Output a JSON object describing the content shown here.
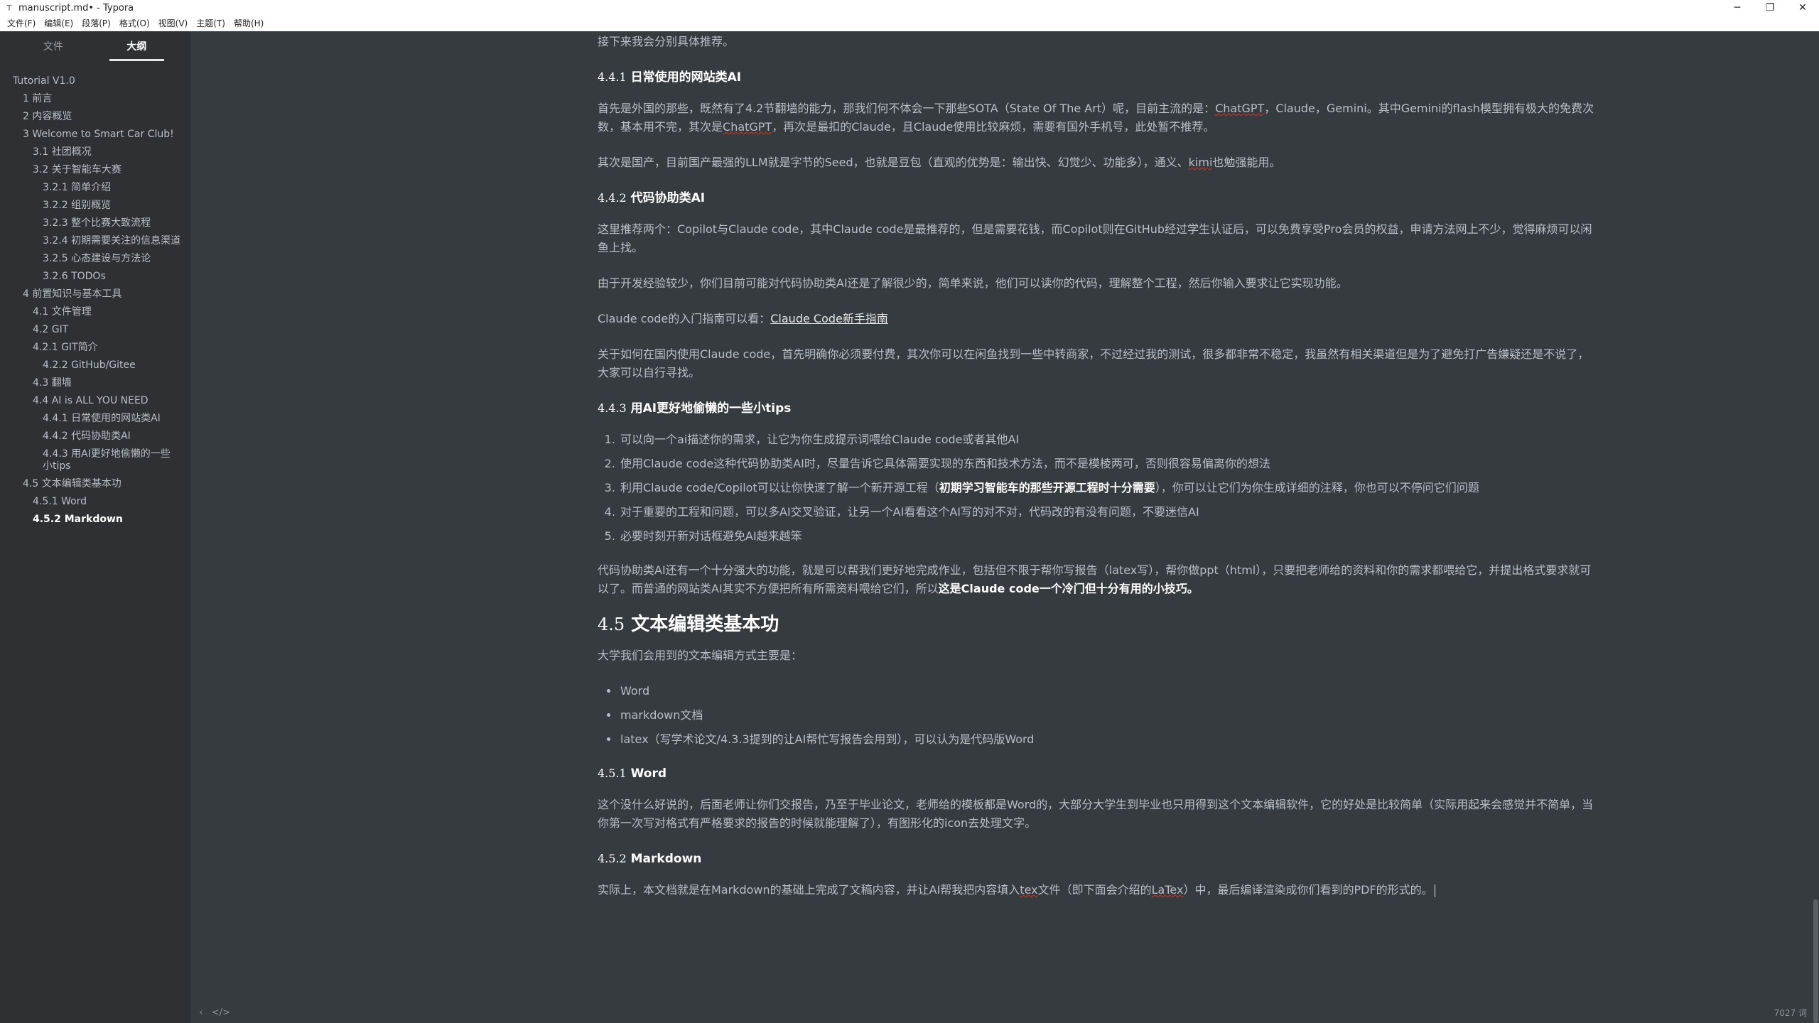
{
  "window": {
    "title": "manuscript.md• - Typora",
    "app_icon": "T",
    "minimize": "─",
    "restore": "❐",
    "close": "✕"
  },
  "menu": [
    "文件(F)",
    "编辑(E)",
    "段落(P)",
    "格式(O)",
    "视图(V)",
    "主题(T)",
    "帮助(H)"
  ],
  "sidebar": {
    "tabs": [
      "文件",
      "大纲"
    ],
    "outline": [
      {
        "text": "Tutorial V1.0",
        "level": 1
      },
      {
        "text": "1 前言",
        "level": 2
      },
      {
        "text": "2 内容概览",
        "level": 2
      },
      {
        "text": "3 Welcome to Smart Car Club!",
        "level": 2
      },
      {
        "text": "3.1 社团概况",
        "level": 3
      },
      {
        "text": "3.2 关于智能车大赛",
        "level": 3
      },
      {
        "text": "3.2.1 简单介绍",
        "level": 4
      },
      {
        "text": "3.2.2 组别概览",
        "level": 4
      },
      {
        "text": "3.2.3 整个比赛大致流程",
        "level": 4
      },
      {
        "text": "3.2.4 初期需要关注的信息渠道",
        "level": 4
      },
      {
        "text": "3.2.5 心态建设与方法论",
        "level": 4
      },
      {
        "text": "3.2.6 TODOs",
        "level": 4
      },
      {
        "text": "4 前置知识与基本工具",
        "level": 2
      },
      {
        "text": "4.1 文件管理",
        "level": 3
      },
      {
        "text": "4.2 GIT",
        "level": 3
      },
      {
        "text": "4.2.1 GIT简介",
        "level": 3
      },
      {
        "text": "4.2.2 GitHub/Gitee",
        "level": 4
      },
      {
        "text": "4.3 翻墙",
        "level": 3
      },
      {
        "text": "4.4 AI is ALL YOU NEED",
        "level": 3
      },
      {
        "text": "4.4.1 日常使用的网站类AI",
        "level": 4
      },
      {
        "text": "4.4.2 代码协助类AI",
        "level": 4
      },
      {
        "text": "4.4.3 用AI更好地偷懒的一些小tips",
        "level": 4
      },
      {
        "text": "4.5 文本编辑类基本功",
        "level": 2
      },
      {
        "text": "4.5.1 Word",
        "level": 3
      },
      {
        "text": "4.5.2 Markdown",
        "level": 3
      }
    ]
  },
  "doc": {
    "p_intro": "接下来我会分别具体推荐。",
    "h441_num": "4.4.1",
    "h441_text": " 日常使用的网站类AI",
    "p1a": "首先是外国的那些，既然有了4.2节翻墙的能力，那我们何不体会一下那些SOTA（State Of The Art）呢，目前主流的是：",
    "p1_chatgpt": "ChatGPT",
    "p1b": "，Claude，Gemini。其中Gemini的flash模型拥有极大的免费次数，基本用不完，其次是",
    "p1_chatgpt2": "ChatGPT",
    "p1c": "，再次是最扣的Claude，且Claude使用比较麻烦，需要有国外手机号，此处暂不推荐。",
    "p2a": "其次是国产，目前国产最强的LLM就是字节的Seed，也就是豆包（直观的优势是：输出快、幻觉少、功能多），通义、",
    "p2_kimi": "kimi",
    "p2b": "也勉强能用。",
    "h442_num": "4.4.2",
    "h442_text": " 代码协助类AI",
    "p3": "这里推荐两个：Copilot与Claude code，其中Claude code是最推荐的，但是需要花钱，而Copilot则在GitHub经过学生认证后，可以免费享受Pro会员的权益，申请方法网上不少，觉得麻烦可以闲鱼上找。",
    "p4": "由于开发经验较少，你们目前可能对代码协助类AI还是了解很少的，简单来说，他们可以读你的代码，理解整个工程，然后你输入要求让它实现功能。",
    "p5_text": "Claude code的入门指南可以看：",
    "p5_link": "Claude Code新手指南",
    "p6": "关于如何在国内使用Claude code，首先明确你必须要付费，其次你可以在闲鱼找到一些中转商家，不过经过我的测试，很多都非常不稳定，我虽然有相关渠道但是为了避免打广告嫌疑还是不说了，大家可以自行寻找。",
    "h443_num": "4.4.3",
    "h443_text": " 用AI更好地偷懒的一些小tips",
    "tip1": "可以向一个ai描述你的需求，让它为你生成提示词喂给Claude code或者其他AI",
    "tip2": "使用Claude code这种代码协助类AI时，尽量告诉它具体需要实现的东西和技术方法，而不是模棱两可，否则很容易偏离你的想法",
    "tip3a": "利用Claude code/Copilot可以让你快速了解一个新开源工程（",
    "tip3_bold": "初期学习智能车的那些开源工程时十分需要",
    "tip3b": "），你可以让它们为你生成详细的注释，你也可以不停问它们问题",
    "tip4": "对于重要的工程和问题，可以多AI交叉验证，让另一个AI看看这个AI写的对不对，代码改的有没有问题，不要迷信AI",
    "tip5": "必要时刻开新对话框避免AI越来越笨",
    "p7a": "代码协助类AI还有一个十分强大的功能，就是可以帮我们更好地完成作业，包括但不限于帮你写报告（latex写），帮你做ppt（html），只要把老师给的资料和你的需求都喂给它，并提出格式要求就可以了。而普通的网站类AI其实不方便把所有所需资料喂给它们，所以",
    "p7_bold": "这是Claude code一个冷门但十分有用的小技巧。",
    "h45_num": "4.5",
    "h45_text": " 文本编辑类基本功",
    "p8": "大学我们会用到的文本编辑方式主要是：",
    "bullet1": "Word",
    "bullet2": "markdown文档",
    "bullet3": "latex（写学术论文/4.3.3提到的让AI帮忙写报告会用到），可以认为是代码版Word",
    "h451_num": "4.5.1",
    "h451_text": " Word",
    "p9": "这个没什么好说的，后面老师让你们交报告，乃至于毕业论文，老师给的模板都是Word的，大部分大学生到毕业也只用得到这个文本编辑软件，它的好处是比较简单（实际用起来会感觉并不简单，当你第一次写对格式有严格要求的报告的时候就能理解了），有图形化的icon去处理文字。",
    "h452_num": "4.5.2",
    "h452_text": " Markdown",
    "p10a": "实际上，本文档就是在Markdown的基础上完成了文稿内容，并让AI帮我把内容填入",
    "p10_tex": "tex",
    "p10b": "文件（即下面会介绍的",
    "p10_latex": "LaTex",
    "p10c": "）中，最后编译渲染成你们看到的PDF的形式的。"
  },
  "status": {
    "back": "‹",
    "source": "</>",
    "word_count": "7027 词"
  }
}
